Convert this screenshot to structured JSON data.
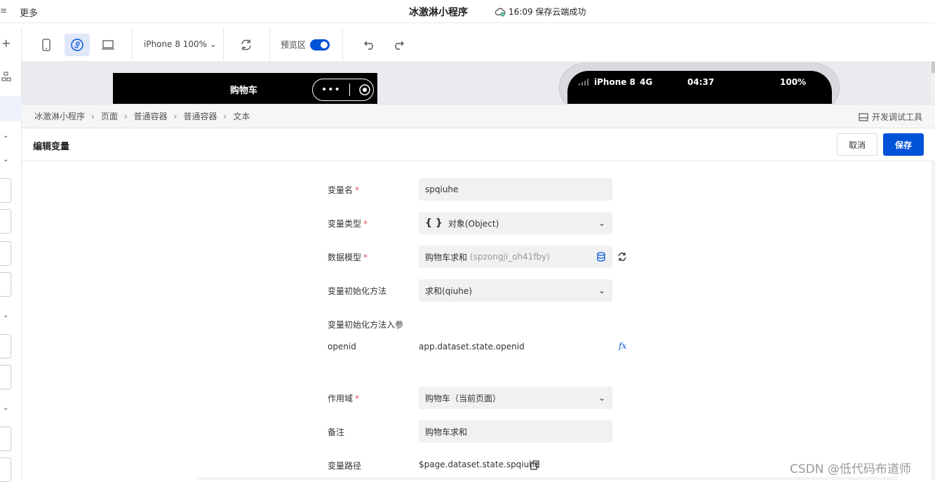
{
  "header": {
    "edge_text": "≡",
    "more_label": "更多",
    "app_title": "冰激淋小程序",
    "save_status": "16:09 保存云端成功"
  },
  "toolbar": {
    "device_select": "iPhone 8 100%",
    "preview_label": "预览区",
    "preview_on": true
  },
  "canvas": {
    "page_title": "购物车",
    "status_bar": {
      "carrier": "iPhone 8",
      "network": "4G",
      "time": "04:37",
      "battery": "100%"
    }
  },
  "breadcrumb": {
    "items": [
      "冰激淋小程序",
      "页面",
      "普通容器",
      "普通容器",
      "文本"
    ],
    "devtools_label": "开发调试工具"
  },
  "panel": {
    "title": "编辑变量",
    "cancel_label": "取消",
    "save_label": "保存"
  },
  "form": {
    "var_name": {
      "label": "变量名",
      "value": "spqiuhe"
    },
    "var_type": {
      "label": "变量类型",
      "icon": "{ }",
      "value": "对象(Object)"
    },
    "data_model": {
      "label": "数据模型",
      "value": "购物车求和",
      "hint": "(spzongji_oh41fby)"
    },
    "init_method": {
      "label": "变量初始化方法",
      "value": "求和(qiuhe)"
    },
    "init_params": {
      "label": "变量初始化方法入参",
      "param_name": "openid",
      "param_value": "app.dataset.state.openid",
      "fx": "fx"
    },
    "scope": {
      "label": "作用域",
      "value": "购物车（当前页面）"
    },
    "remark": {
      "label": "备注",
      "value": "购物车求和"
    },
    "path": {
      "label": "变量路径",
      "value": "$page.dataset.state.spqiuhe"
    }
  },
  "watermark": "CSDN @低代码布道师",
  "colors": {
    "primary": "#0052d9",
    "required": "#e34d59",
    "success": "#2ba471"
  }
}
